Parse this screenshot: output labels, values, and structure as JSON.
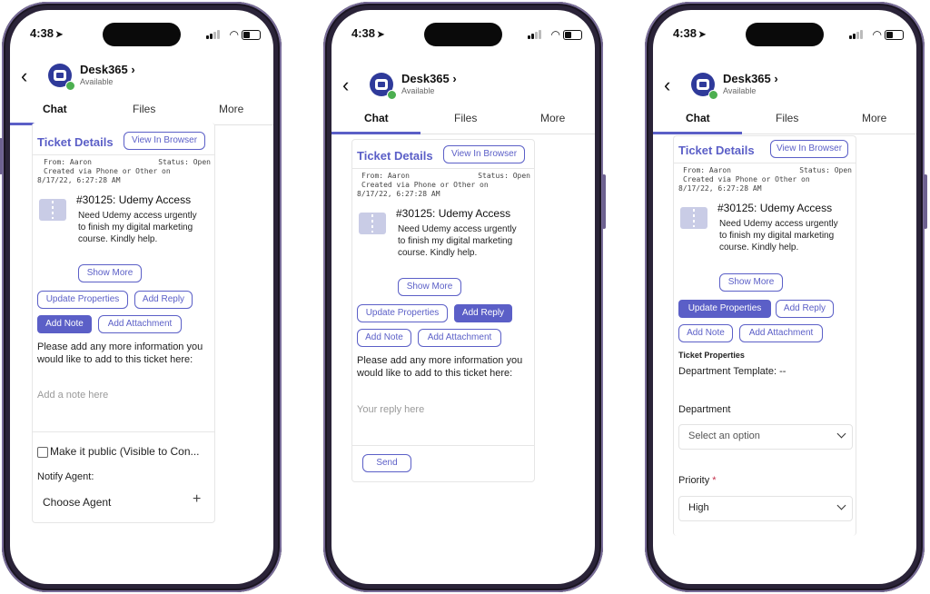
{
  "status": {
    "time": "4:38"
  },
  "app": {
    "name": "Desk365",
    "chevron": "›",
    "presence": "Available",
    "back": "‹"
  },
  "tabs": [
    "Chat",
    "Files",
    "More"
  ],
  "ticket": {
    "section_title": "Ticket Details",
    "view_in_browser": "View In Browser",
    "meta_from": "From: Aaron",
    "meta_status": "Status: Open",
    "meta_created": "Created via Phone or Other on",
    "meta_date": "8/17/22, 6:27:28 AM",
    "title": "#30125: Udemy Access",
    "description": "Need Udemy access urgently to finish my digital marketing course. Kindly help.",
    "show_more": "Show More"
  },
  "actions": {
    "update_properties": "Update Properties",
    "add_reply": "Add Reply",
    "add_note": "Add Note",
    "add_attachment": "Add Attachment"
  },
  "screen1": {
    "prompt": "Please add any more information you would like to add to this ticket here:",
    "note_placeholder": "Add a note here",
    "make_public": "Make it public (Visible to Con...",
    "notify_agent": "Notify Agent:",
    "choose_agent": "Choose Agent",
    "plus": "+"
  },
  "screen2": {
    "prompt": "Please add any more information you would like to add to this ticket here:",
    "reply_placeholder": "Your reply here",
    "send": "Send"
  },
  "screen3": {
    "ticket_properties": "Ticket Properties",
    "department_template": "Department Template: --",
    "department_label": "Department",
    "department_value": "Select an option",
    "priority_label": "Priority",
    "priority_required": "*",
    "priority_value": "High"
  },
  "colors": {
    "accent": "#5b5fc7",
    "presence": "#4caf50",
    "required": "#c4314b"
  }
}
